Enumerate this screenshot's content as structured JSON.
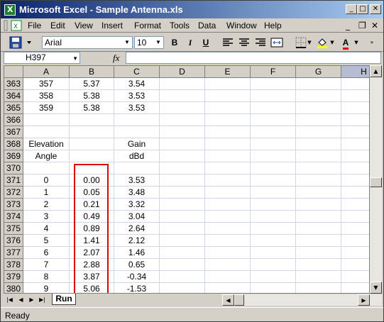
{
  "window": {
    "title": "Microsoft Excel - Sample Antenna.xls",
    "app_icon": "X",
    "minimize_glyph": "_",
    "maximize_glyph": "□",
    "close_glyph": "✕"
  },
  "menubar": {
    "items": [
      {
        "label": "File"
      },
      {
        "label": "Edit"
      },
      {
        "label": "View"
      },
      {
        "label": "Insert"
      },
      {
        "label": "Format"
      },
      {
        "label": "Tools"
      },
      {
        "label": "Data"
      },
      {
        "label": "Window"
      },
      {
        "label": "Help"
      }
    ],
    "doc_minimize": "_",
    "doc_restore": "❐",
    "doc_close": "✕"
  },
  "toolbar": {
    "font_name": "Arial",
    "font_size": "10",
    "bold": "B",
    "italic": "I",
    "underline": "U",
    "font_color_label": "A",
    "icons": [
      "save-icon",
      "align-left-icon",
      "align-center-icon",
      "align-right-icon",
      "merge-center-icon",
      "borders-icon",
      "fill-color-icon",
      "font-color-icon"
    ],
    "accent_red": "#e00000",
    "fill_yellow": "#ffff00"
  },
  "formula_bar": {
    "name_box": "H397",
    "fx_label": "fx",
    "formula": ""
  },
  "grid": {
    "columns": [
      "A",
      "B",
      "C",
      "D",
      "E",
      "F",
      "G",
      "H"
    ],
    "active_column": "H",
    "rows": [
      {
        "n": "363",
        "cells": [
          "357",
          "5.37",
          "3.54"
        ]
      },
      {
        "n": "364",
        "cells": [
          "358",
          "5.38",
          "3.53"
        ]
      },
      {
        "n": "365",
        "cells": [
          "359",
          "5.38",
          "3.53"
        ]
      },
      {
        "n": "366",
        "cells": [
          "",
          "",
          ""
        ]
      },
      {
        "n": "367",
        "cells": [
          "",
          "",
          ""
        ]
      },
      {
        "n": "368",
        "cells": [
          "Elevation",
          "",
          "Gain"
        ]
      },
      {
        "n": "369",
        "cells": [
          "Angle",
          "",
          "dBd"
        ]
      },
      {
        "n": "370",
        "cells": [
          "",
          "",
          ""
        ]
      },
      {
        "n": "371",
        "cells": [
          "0",
          "0.00",
          "3.53"
        ]
      },
      {
        "n": "372",
        "cells": [
          "1",
          "0.05",
          "3.48"
        ]
      },
      {
        "n": "373",
        "cells": [
          "2",
          "0.21",
          "3.32"
        ]
      },
      {
        "n": "374",
        "cells": [
          "3",
          "0.49",
          "3.04"
        ]
      },
      {
        "n": "375",
        "cells": [
          "4",
          "0.89",
          "2.64"
        ]
      },
      {
        "n": "376",
        "cells": [
          "5",
          "1.41",
          "2.12"
        ]
      },
      {
        "n": "377",
        "cells": [
          "6",
          "2.07",
          "1.46"
        ]
      },
      {
        "n": "378",
        "cells": [
          "7",
          "2.88",
          "0.65"
        ]
      },
      {
        "n": "379",
        "cells": [
          "8",
          "3.87",
          "-0.34"
        ]
      },
      {
        "n": "380",
        "cells": [
          "9",
          "5.06",
          "-1.53"
        ]
      }
    ],
    "highlight_color": "#e00000"
  },
  "sheet_tabs": {
    "tabs": [
      {
        "label": "Run",
        "active": true
      }
    ]
  },
  "status_bar": {
    "text": "Ready"
  }
}
